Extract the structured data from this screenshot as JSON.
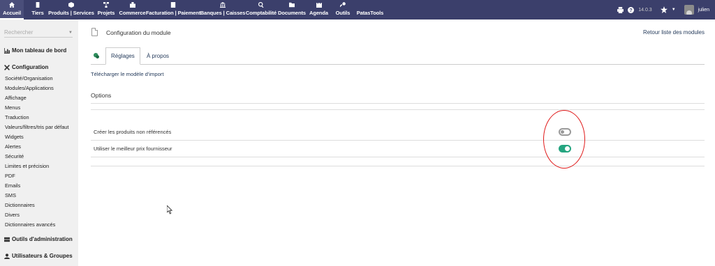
{
  "topbar": {
    "menu": [
      {
        "label": "Accueil",
        "icon": "home-icon"
      },
      {
        "label": "Tiers",
        "icon": "building-icon"
      },
      {
        "label": "Produits | Services",
        "icon": "cube-icon"
      },
      {
        "label": "Projets",
        "icon": "sitemap-icon"
      },
      {
        "label": "Commerce",
        "icon": "suitcase-icon"
      },
      {
        "label": "Facturation | Paiement",
        "icon": "invoice-icon"
      },
      {
        "label": "Banques | Caisses",
        "icon": "bank-icon"
      },
      {
        "label": "Comptabilité",
        "icon": "search-dollar-icon"
      },
      {
        "label": "Documents",
        "icon": "folder-icon"
      },
      {
        "label": "Agenda",
        "icon": "calendar-icon"
      },
      {
        "label": "Outils",
        "icon": "wrench-icon"
      },
      {
        "label": "PatasTools",
        "icon": ""
      }
    ],
    "version": "14.0.3",
    "user": "julien"
  },
  "sidebar": {
    "search_placeholder": "Rechercher",
    "dashboard": "Mon tableau de bord",
    "config_title": "Configuration",
    "links": [
      "Société/Organisation",
      "Modules/Applications",
      "Affichage",
      "Menus",
      "Traduction",
      "Valeurs/filtres/tris par défaut",
      "Widgets",
      "Alertes",
      "Sécurité",
      "Limites et précision",
      "PDF",
      "Emails",
      "SMS",
      "Dictionnaires",
      "Divers",
      "Dictionnaires avancés"
    ],
    "admin_tools": "Outils d'administration",
    "users_groups": "Utilisateurs & Groupes"
  },
  "main": {
    "title": "Configuration du module",
    "back_link": "Retour liste des modules",
    "tabs": [
      "Réglages",
      "À propos"
    ],
    "download_link": "Télécharger le modèle d'import",
    "options_title": "Options",
    "options": [
      {
        "label": "Créer les produits non référencés",
        "enabled": false
      },
      {
        "label": "Utiliser le meilleur prix fournisseur",
        "enabled": true
      }
    ]
  },
  "colors": {
    "topbar": "#3b3f6b",
    "sidebar": "#f0f0f0",
    "link": "#263c5c",
    "toggle_on": "#25a580",
    "annotation": "#e01a1a"
  }
}
